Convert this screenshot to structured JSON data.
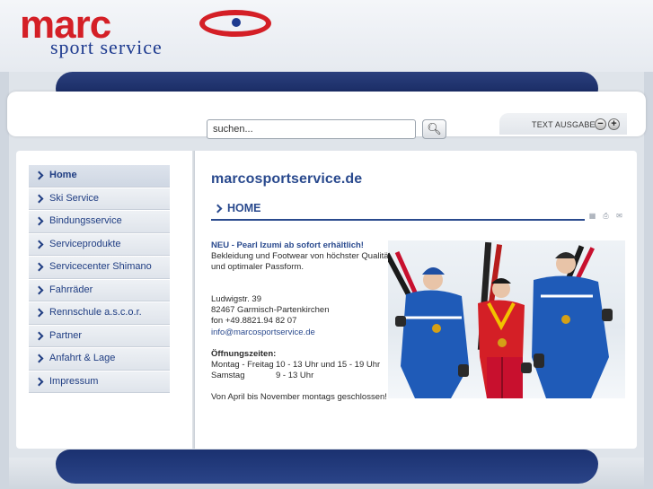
{
  "brand": {
    "logo_word": "marc",
    "logo_sub": "sport service"
  },
  "search": {
    "placeholder": "suchen...",
    "value": "suchen..."
  },
  "text_size": {
    "label": "TEXT AUSGABE",
    "decrease": "−",
    "increase": "+"
  },
  "nav": {
    "items": [
      {
        "label": "Home",
        "active": true
      },
      {
        "label": "Ski Service"
      },
      {
        "label": "Bindungsservice"
      },
      {
        "label": "Serviceprodukte"
      },
      {
        "label": "Servicecenter Shimano"
      },
      {
        "label": "Fahrräder"
      },
      {
        "label": "Rennschule a.s.c.o.r."
      },
      {
        "label": "Partner"
      },
      {
        "label": "Anfahrt & Lage"
      },
      {
        "label": "Impressum"
      }
    ]
  },
  "main": {
    "site_title": "marcosportservice.de",
    "section_title": "HOME",
    "tools": [
      "pdf-icon",
      "print-icon",
      "email-icon"
    ],
    "news_headline": "NEU - Pearl Izumi ab sofort erhältlich!",
    "news_body_1": "Bekleidung und Footwear von höchster Qualität",
    "news_body_2": "und optimaler Passform.",
    "address_street": "Ludwigstr. 39",
    "address_city": "82467 Garmisch-Partenkirchen",
    "phone": "fon +49.8821.94 82 07",
    "email": "info@marcosportservice.de",
    "hours_title": "Öffnungszeiten:",
    "hours": [
      {
        "day": "Montag - Freitag",
        "time": "10 - 13 Uhr und 15 - 19 Uhr"
      },
      {
        "day": "Samstag",
        "time": "9 - 13 Uhr"
      }
    ],
    "closure_note": "Von April bis November montags geschlossen!"
  },
  "colors": {
    "brand_red": "#d41f26",
    "brand_blue": "#1d3a8f",
    "link_blue": "#2a4a8e",
    "bar_navy": "#13245a"
  }
}
